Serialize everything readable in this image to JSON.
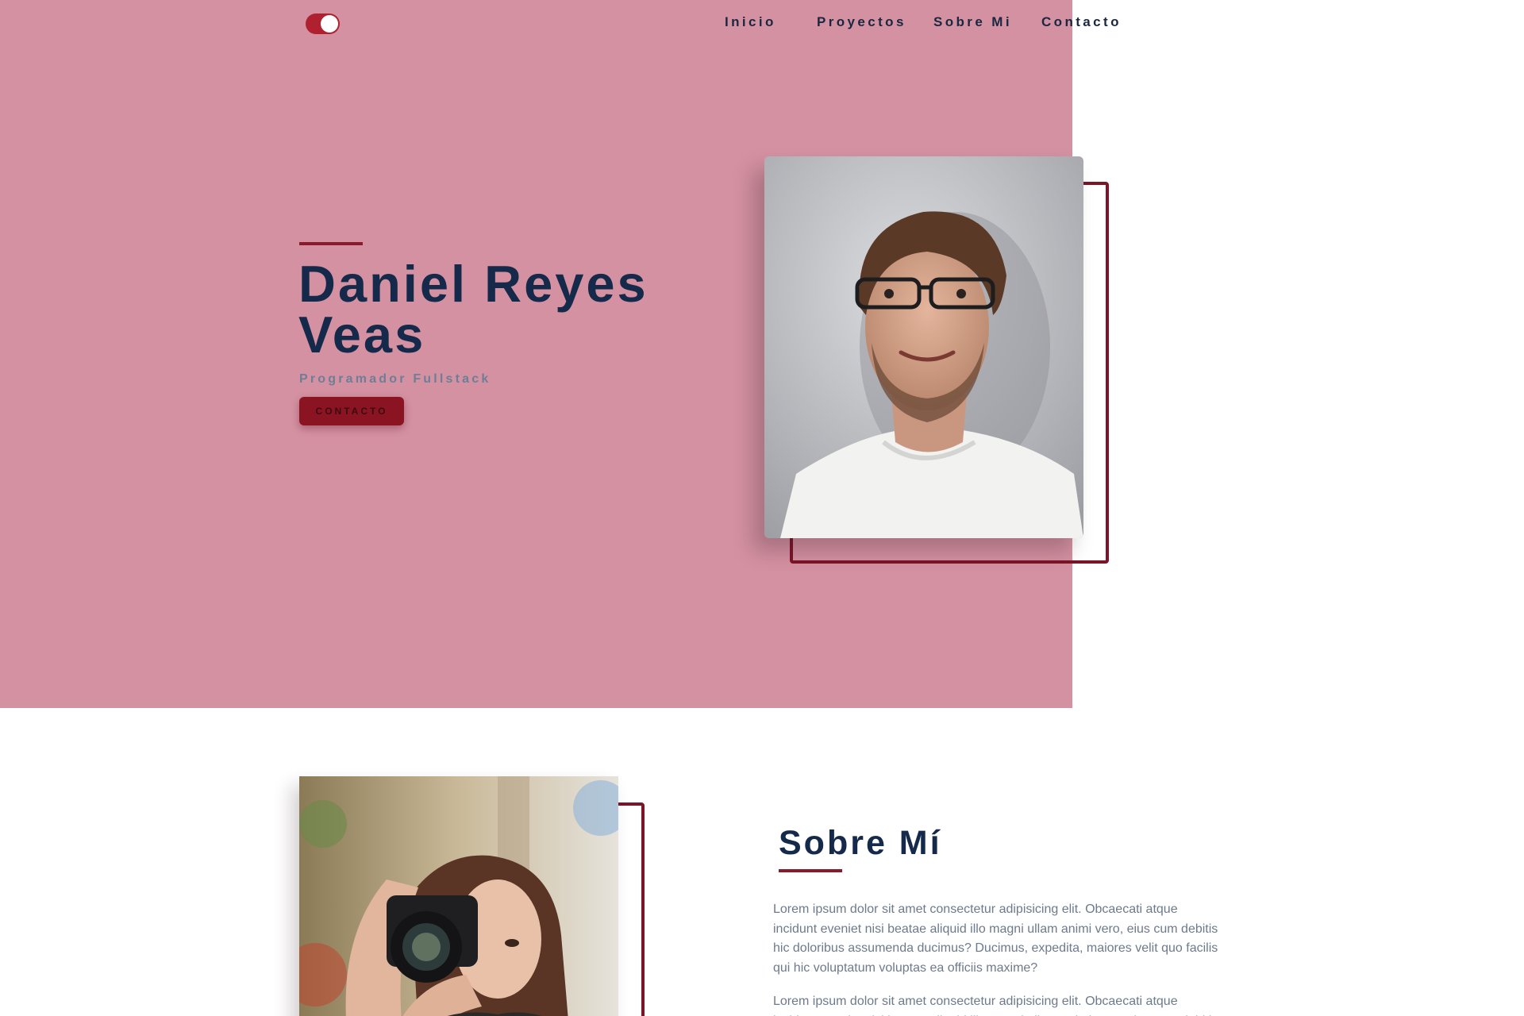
{
  "header": {
    "theme_toggle": {
      "state": "on",
      "icon": "toggle-icon"
    },
    "nav": [
      {
        "label": "Inicio"
      },
      {
        "label": "Proyectos"
      },
      {
        "label": "Sobre Mi"
      },
      {
        "label": "Contacto"
      }
    ]
  },
  "hero": {
    "name": "Daniel Reyes Veas",
    "role": "Programador Fullstack",
    "button_label": "CONTACTO",
    "photo": "portrait-man-glasses"
  },
  "about": {
    "title": "Sobre Mí",
    "photo": "woman-with-camera",
    "paragraphs": [
      "Lorem ipsum dolor sit amet consectetur adipisicing elit. Obcaecati atque incidunt eveniet nisi beatae aliquid illo magni ullam animi vero, eius cum debitis hic doloribus assumenda ducimus? Ducimus, expedita, maiores velit quo facilis qui hic voluptatum voluptas ea officiis maxime?",
      "Lorem ipsum dolor sit amet consectetur adipisicing elit. Obcaecati atque incidunt eveniet nisi beatae aliquid illo magni ullam animi vero, eius cum debitis"
    ]
  },
  "colors": {
    "hero_background": "#d491a1",
    "accent": "#8b1a2b",
    "heading": "#15294a",
    "body_text": "#6d7a8c",
    "toggle": "#b0212f"
  }
}
